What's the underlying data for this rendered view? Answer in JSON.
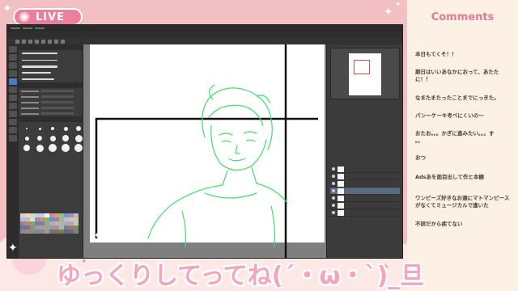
{
  "live_badge": {
    "label": "LIVE"
  },
  "comments_panel": {
    "title": "Comments",
    "items": [
      {
        "message": "本日もてくそ！！"
      },
      {
        "message": "期日はいいあなかにおって、あたたに！！"
      },
      {
        "message": "なまたまたったことまでにっきた。"
      },
      {
        "message": "パンーケーキ考べにくいの～"
      },
      {
        "message": "おたお。。。かぎに進みたい。。。す\n。。"
      },
      {
        "message": "おつ"
      },
      {
        "message": "Adsあを面目出して作と本棚"
      },
      {
        "message": "ワンピーズ好きなお適にマトマンピースがなくてミュージカルで逢いた"
      },
      {
        "message": "不詳だから疾てない"
      }
    ]
  },
  "caption": {
    "text": "ゆっくりしてってね(´・ω・`)_旦"
  },
  "colors": {
    "accent_pink": "#ea7f9e",
    "background_pink": "#f2c0c3",
    "comments_bg": "#fdf1e6",
    "sketch_green": "#3ee06a",
    "caption_pink": "#f4a5bd"
  }
}
